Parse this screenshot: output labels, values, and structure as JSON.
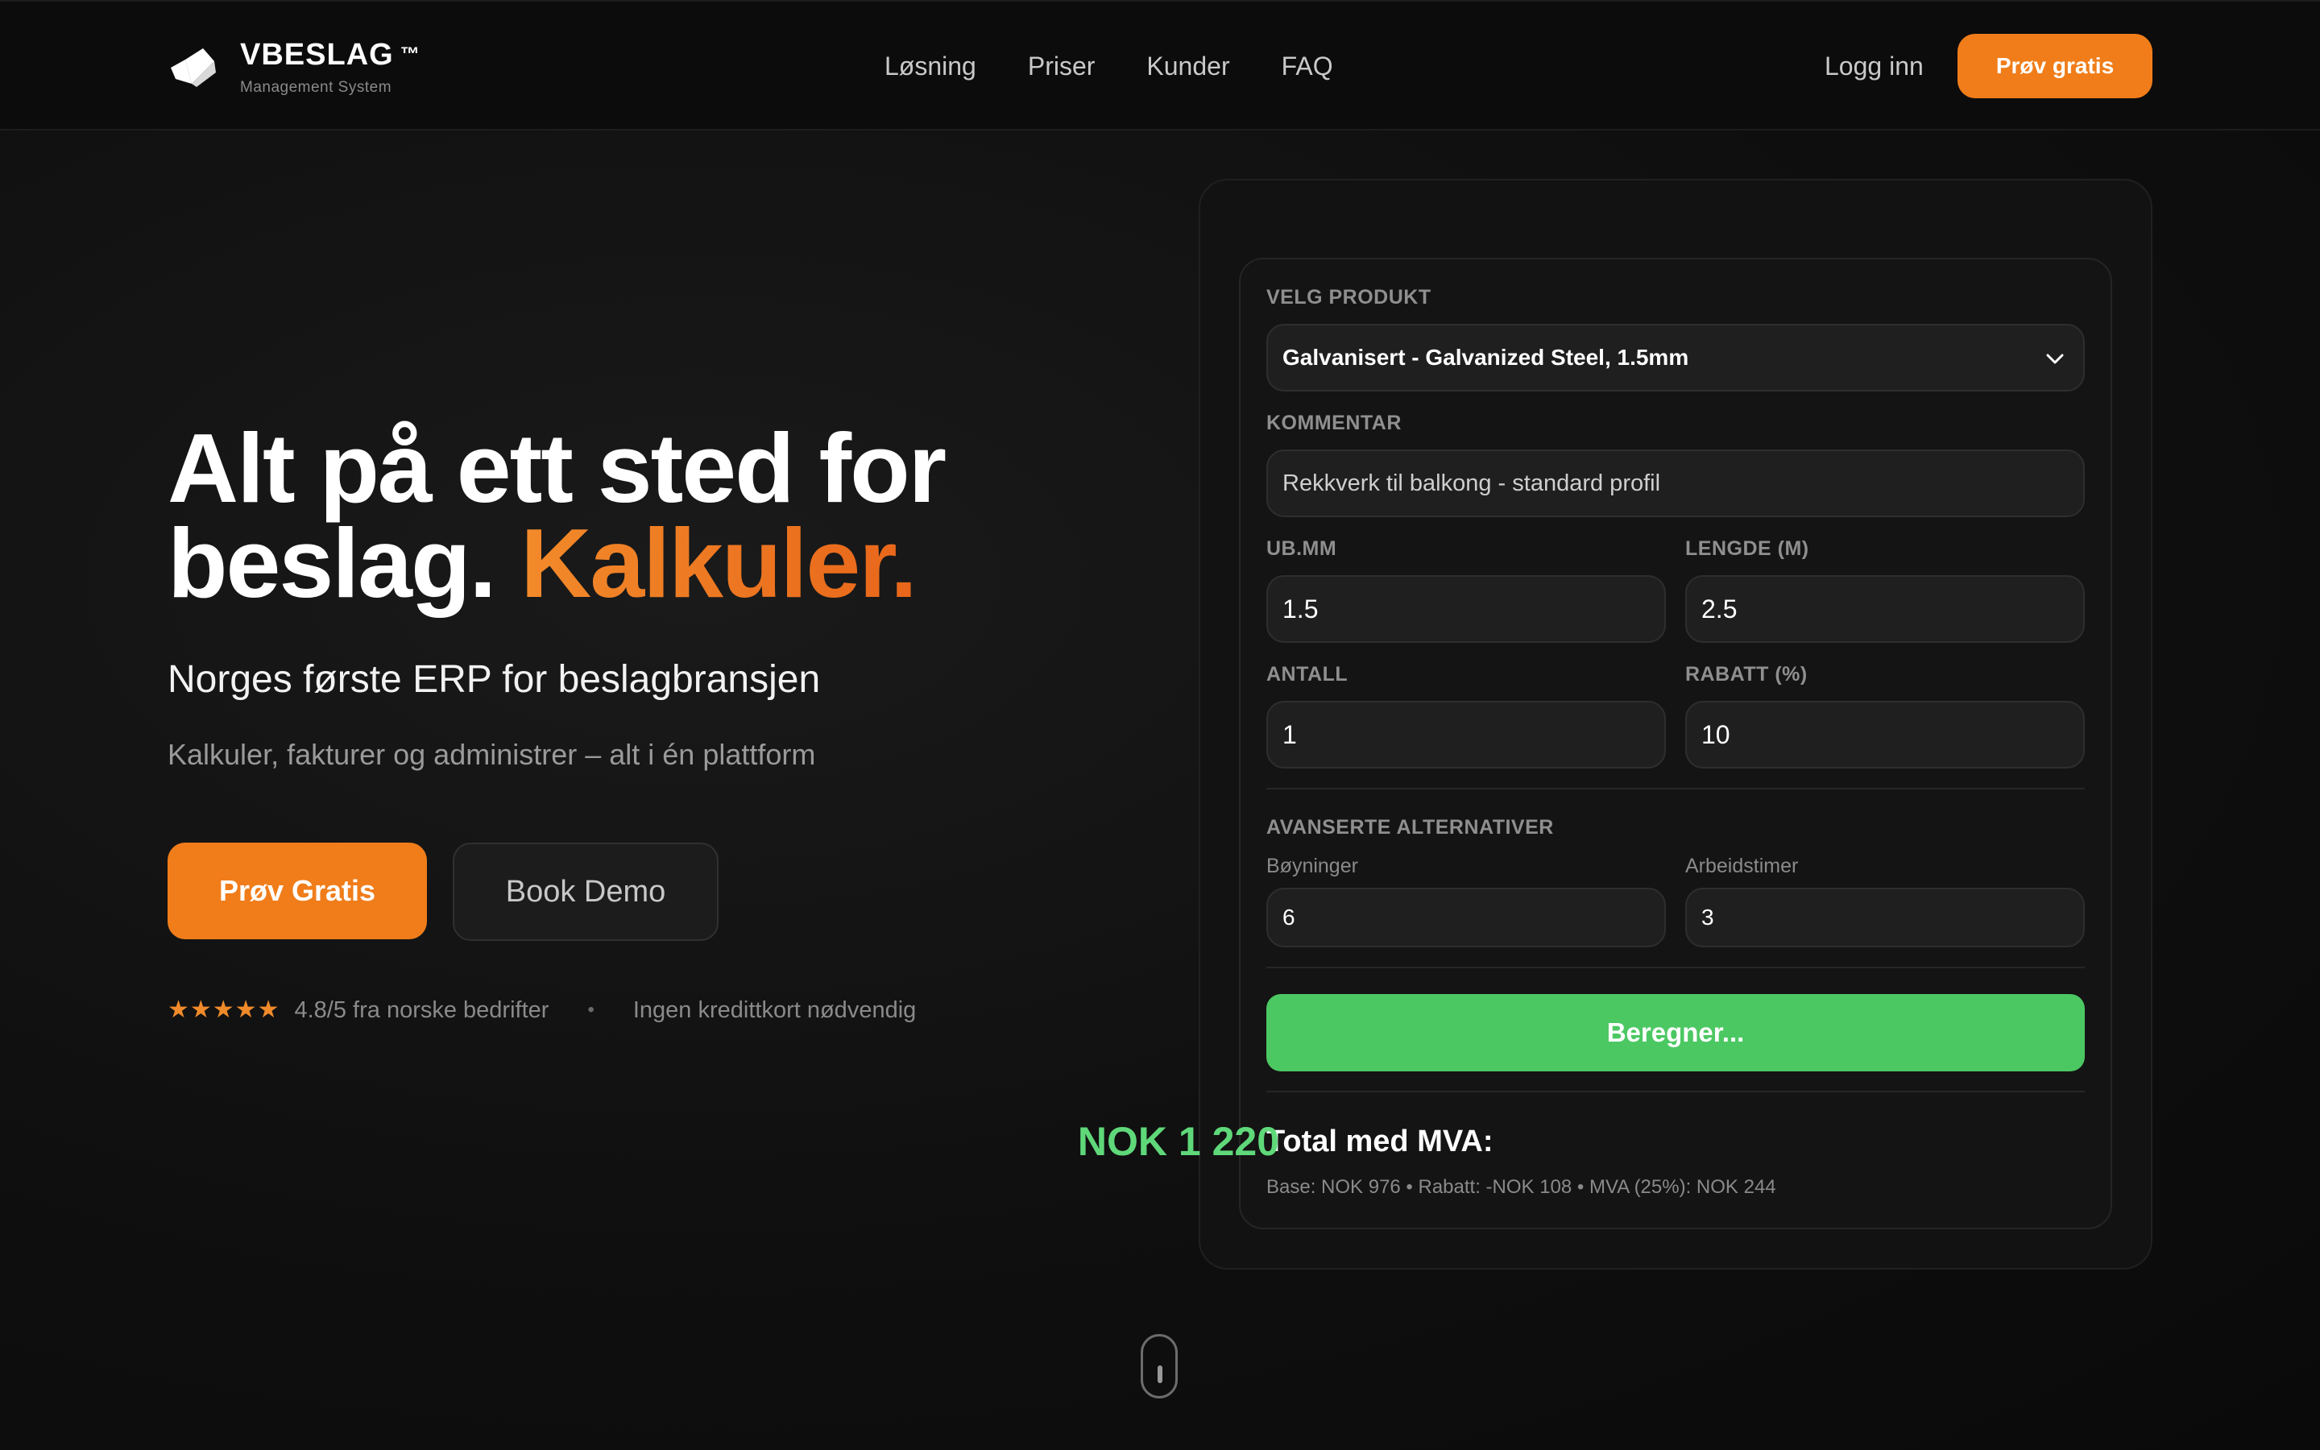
{
  "brand": {
    "name": "VBESLAG",
    "tm": "™",
    "tagline": "Management System"
  },
  "nav": {
    "items": [
      "Løsning",
      "Priser",
      "Kunder",
      "FAQ"
    ],
    "login": "Logg inn",
    "cta": "Prøv gratis"
  },
  "hero": {
    "title_line1": "Alt på ett sted for",
    "title_line2": "beslag.",
    "title_accent": "Kalkuler.",
    "subtitle": "Norges første ERP for beslagbransjen",
    "description": "Kalkuler, fakturer og administrer – alt i én plattform",
    "primary_button": "Prøv Gratis",
    "secondary_button": "Book Demo",
    "rating_stars": "★★★★★",
    "rating_text": "4.8/5 fra norske bedrifter",
    "separator": "•",
    "no_card_text": "Ingen kredittkort nødvendig"
  },
  "calculator": {
    "product_label": "VELG PRODUKT",
    "product_value": "Galvanisert - Galvanized Steel, 1.5mm",
    "comment_label": "KOMMENTAR",
    "comment_value": "Rekkverk til balkong - standard profil",
    "thickness_label": "UB.MM",
    "thickness_value": "1.5",
    "length_label": "LENGDE (M)",
    "length_value": "2.5",
    "quantity_label": "ANTALL",
    "quantity_value": "1",
    "discount_label": "RABATT (%)",
    "discount_value": "10",
    "advanced_label": "AVANSERTE ALTERNATIVER",
    "bends_label": "Bøyninger",
    "bends_value": "6",
    "hours_label": "Arbeidstimer",
    "hours_value": "3",
    "calc_button": "Beregner...",
    "total_label": "Total med MVA:",
    "total_value": "NOK 1 220",
    "breakdown": "Base: NOK 976 • Rabatt: -NOK 108 • MVA (25%): NOK 244"
  },
  "colors": {
    "accent": "#f07d1a",
    "success": "#4cc863",
    "total": "#5fd87a",
    "background": "#0d0d0d"
  }
}
